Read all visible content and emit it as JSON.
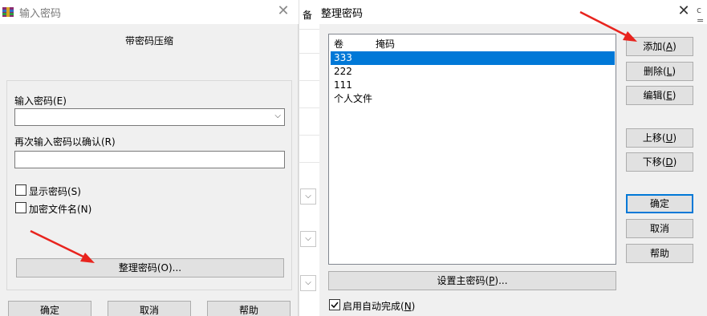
{
  "left_dialog": {
    "title": "输入密码",
    "heading": "带密码压缩",
    "password_label": "输入密码(E)",
    "confirm_label": "再次输入密码以确认(R)",
    "show_password_label": "显示密码(S)",
    "encrypt_filenames_label": "加密文件名(N)",
    "organize_button": "整理密码(O)...",
    "ok_button": "确定",
    "cancel_button": "取消",
    "help_button": "帮助"
  },
  "right_dialog": {
    "title": "整理密码",
    "list_headers": [
      "卷",
      "掩码"
    ],
    "rows": [
      "333",
      "222",
      "111",
      "个人文件"
    ],
    "selected_index": 0,
    "buttons": {
      "add_text": "添加(",
      "add_key": "A",
      "add_end": ")",
      "delete_text": "删除(",
      "delete_key": "L",
      "delete_end": ")",
      "edit_text": "编辑(",
      "edit_key": "E",
      "edit_end": ")",
      "up_text": "上移(",
      "up_key": "U",
      "up_end": ")",
      "down_text": "下移(",
      "down_key": "D",
      "down_end": ")",
      "ok": "确定",
      "cancel": "取消",
      "help": "帮助"
    },
    "master_password_text": "设置主密码(",
    "master_password_key": "P",
    "master_password_end": ")...",
    "autocomplete_text": "启用自动完成(",
    "autocomplete_key": "N",
    "autocomplete_end": ")",
    "autocomplete_checked": true
  },
  "background": {
    "fragment_text": "备",
    "fragment_right": "c ="
  },
  "colors": {
    "selection": "#0078d7",
    "arrow": "#e8241e",
    "default_button_border": "#0078d7"
  }
}
